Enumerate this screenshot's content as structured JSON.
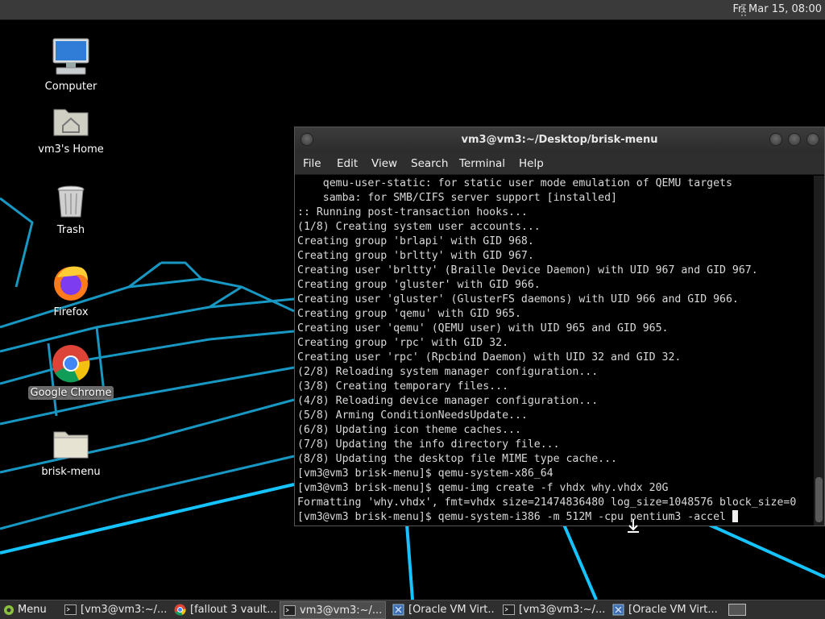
{
  "top_panel": {
    "clock": "Fri Mar 15, 08:00"
  },
  "desktop": {
    "icons": [
      {
        "label": "Computer"
      },
      {
        "label": "vm3's Home"
      },
      {
        "label": "Trash"
      },
      {
        "label": "Firefox"
      },
      {
        "label": "Google Chrome",
        "selected": true
      },
      {
        "label": "brisk-menu"
      }
    ]
  },
  "terminal": {
    "title": "vm3@vm3:~/Desktop/brisk-menu",
    "menu": [
      "File",
      "Edit",
      "View",
      "Search",
      "Terminal",
      "Help"
    ],
    "lines": [
      "    qemu-user-static: for static user mode emulation of QEMU targets",
      "    samba: for SMB/CIFS server support [installed]",
      ":: Running post-transaction hooks...",
      "(1/8) Creating system user accounts...",
      "Creating group 'brlapi' with GID 968.",
      "Creating group 'brltty' with GID 967.",
      "Creating user 'brltty' (Braille Device Daemon) with UID 967 and GID 967.",
      "Creating group 'gluster' with GID 966.",
      "Creating user 'gluster' (GlusterFS daemons) with UID 966 and GID 966.",
      "Creating group 'qemu' with GID 965.",
      "Creating user 'qemu' (QEMU user) with UID 965 and GID 965.",
      "Creating group 'rpc' with GID 32.",
      "Creating user 'rpc' (Rpcbind Daemon) with UID 32 and GID 32.",
      "(2/8) Reloading system manager configuration...",
      "(3/8) Creating temporary files...",
      "(4/8) Reloading device manager configuration...",
      "(5/8) Arming ConditionNeedsUpdate...",
      "(6/8) Updating icon theme caches...",
      "(7/8) Updating the info directory file...",
      "(8/8) Updating the desktop file MIME type cache...",
      "[vm3@vm3 brisk-menu]$ qemu-system-x86_64",
      "[vm3@vm3 brisk-menu]$ qemu-img create -f vhdx why.vhdx 20G",
      "Formatting 'why.vhdx', fmt=vhdx size=21474836480 log_size=1048576 block_size=0"
    ],
    "prompt_line": "[vm3@vm3 brisk-menu]$ qemu-system-i386 -m 512M -cpu pentium3 -accel "
  },
  "taskbar": {
    "menu_label": "Menu",
    "tasks": [
      {
        "label": "[vm3@vm3:~/...",
        "icon": "terminal-icon"
      },
      {
        "label": "[fallout 3 vault...",
        "icon": "chrome-icon"
      },
      {
        "label": "vm3@vm3:~/...",
        "icon": "terminal-icon",
        "active": true
      },
      {
        "label": "[Oracle VM Virt...",
        "icon": "virtualbox-icon"
      },
      {
        "label": "[vm3@vm3:~/...",
        "icon": "terminal-icon"
      },
      {
        "label": "[Oracle VM Virt...",
        "icon": "virtualbox-icon"
      }
    ]
  }
}
